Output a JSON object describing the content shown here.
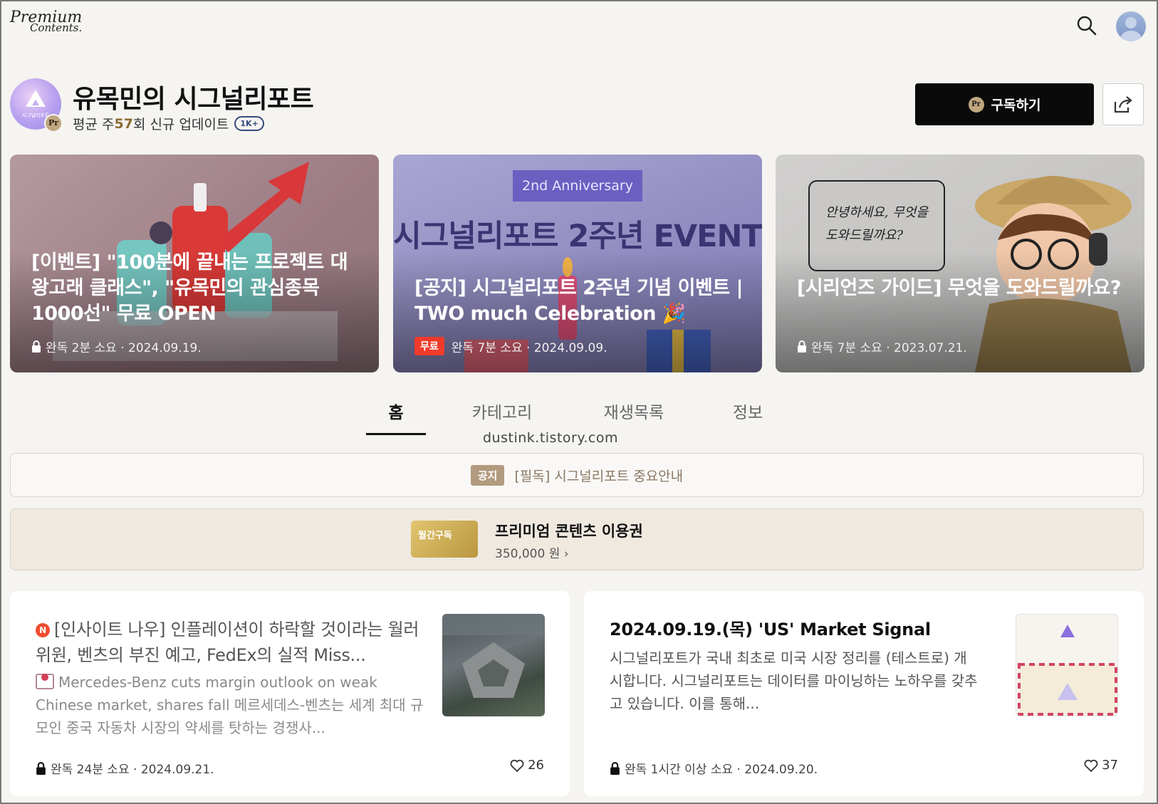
{
  "header": {
    "logo_line1": "Premium",
    "logo_line2": "Contents."
  },
  "channel": {
    "logo_text": "시그널리포트",
    "pr_badge": "Pr",
    "title": "유목민의 시그널리포트",
    "sub_prefix": "평균 주 ",
    "sub_count": "57",
    "sub_suffix": "회 신규 업데이트",
    "count_badge": "1K+",
    "subscribe_label": "구독하기"
  },
  "banners": [
    {
      "title": "[이벤트] \"100분에 끝내는 프로젝트 대왕고래 클래스\", \"유목민의 관심종목 1000선\" 무료 OPEN",
      "meta": "완독 2분 소요 · 2024.09.19."
    },
    {
      "ribbon": "2nd Anniversary",
      "big": "시그널리포트 2주년 EVENT",
      "title": "[공지] 시그널리포트 2주년 기념 이벤트 | TWO much Celebration 🎉",
      "free": "무료",
      "meta": "완독 7분 소요 · 2024.09.09."
    },
    {
      "bubble": "안녕하세요, 무엇을 도와드릴까요?",
      "title": "[시리언즈 가이드] 무엇을 도와드릴까요?",
      "meta": "완독 7분 소요 · 2023.07.21."
    }
  ],
  "tabs": [
    "홈",
    "카테고리",
    "재생목록",
    "정보"
  ],
  "watermark": "dustink.tistory.com",
  "notice": {
    "tag": "공지",
    "text": "[필독] 시그널리포트 중요안내"
  },
  "pass": {
    "card_label": "월간구독",
    "name": "프리미엄 콘텐츠 이용권",
    "price": "350,000 원 ›"
  },
  "posts": [
    {
      "badge": "N",
      "title": "[인사이트 나우] 인플레이션이 하락할 것이라는 월러 위원, 벤츠의 부진 예고, FedEx의 실적 Miss...",
      "desc": "Mercedes-Benz cuts margin outlook on weak Chinese market, shares fall 메르세데스-벤츠는 세계 최대 규모인 중국 자동차 시장의 약세를 탓하는 경쟁사...",
      "meta": "완독 24분 소요 · 2024.09.21.",
      "likes": "26"
    },
    {
      "title": "2024.09.19.(목) 'US' Market Signal",
      "desc": "시그널리포트가 국내 최초로 미국 시장 정리를 (테스트로) 개시합니다. 시그널리포트는 데이터를 마이닝하는 노하우를 갖추고 있습니다. 이를 통해...",
      "meta": "완독 1시간 이상 소요 · 2024.09.20.",
      "likes": "37"
    }
  ],
  "colors": {
    "accent_gold": "#bfa77f",
    "free_red": "#ef3b2c",
    "button_black": "#0a0a0a"
  }
}
